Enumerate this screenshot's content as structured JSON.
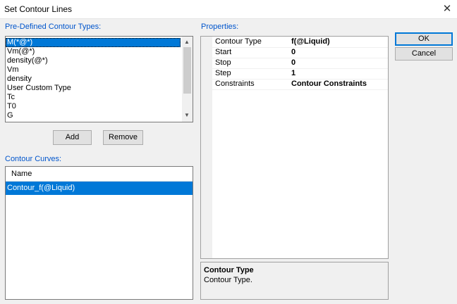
{
  "window": {
    "title": "Set Contour Lines",
    "close_glyph": "✕"
  },
  "predefined": {
    "label": "Pre-Defined Contour Types:",
    "items": [
      "M(*@*)",
      "Vm(@*)",
      "density(@*)",
      "Vm",
      "density",
      "User Custom Type",
      "Tc",
      "T0",
      "G"
    ],
    "selected_index": 0
  },
  "buttons": {
    "add": "Add",
    "remove": "Remove",
    "ok": "OK",
    "cancel": "Cancel"
  },
  "curves": {
    "label": "Contour Curves:",
    "column_header": "Name",
    "rows": [
      "Contour_f(@Liquid)"
    ]
  },
  "properties": {
    "label": "Properties:",
    "rows": [
      {
        "name": "Contour Type",
        "value": "f(@Liquid)"
      },
      {
        "name": "Start",
        "value": "0"
      },
      {
        "name": "Stop",
        "value": "0"
      },
      {
        "name": "Step",
        "value": "1"
      },
      {
        "name": "Constraints",
        "value": "Contour Constraints"
      }
    ],
    "description_title": "Contour Type",
    "description_text": "Contour Type."
  },
  "colors": {
    "selection": "#0078d7",
    "section_label": "#0055cc"
  }
}
